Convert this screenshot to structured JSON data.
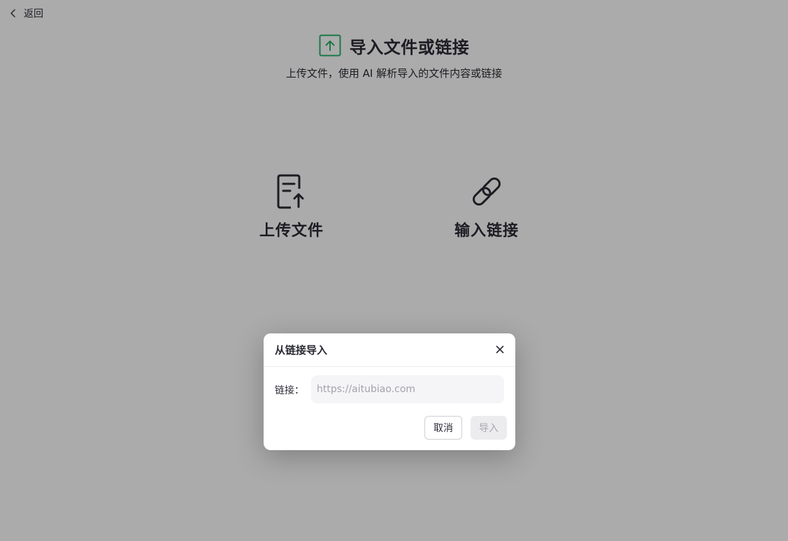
{
  "nav": {
    "back_icon": "chevron-left-icon",
    "back_label": "返回"
  },
  "hero": {
    "icon": "upload-arrow-icon",
    "title": "导入文件或链接",
    "subtitle": "上传文件，使用 AI 解析导入的文件内容或链接"
  },
  "options": [
    {
      "icon": "file-upload-icon",
      "label": "上传文件"
    },
    {
      "icon": "link-icon",
      "label": "输入链接"
    }
  ],
  "modal": {
    "title": "从链接导入",
    "close_icon": "close-icon",
    "field_label": "链接：",
    "input_value": "",
    "input_placeholder": "https://aitubiao.com",
    "cancel_label": "取消",
    "import_label": "导入"
  },
  "colors": {
    "accent": "#27b36b",
    "text": "#2b2b35",
    "overlay": "rgba(0,0,0,0.33)",
    "disabled_bg": "#ececef"
  }
}
